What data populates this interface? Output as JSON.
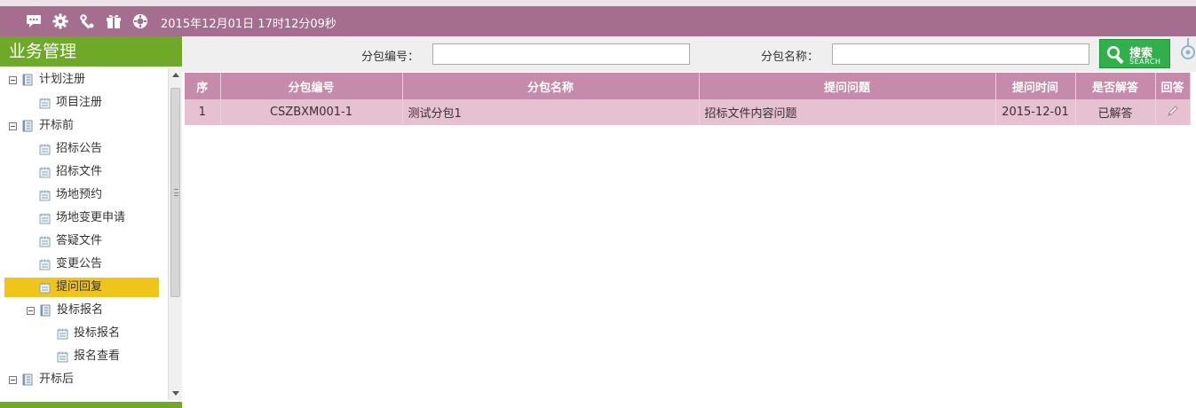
{
  "header": {
    "datetime": "2015年12月01日 17时12分09秒",
    "icons": [
      "chat-bubble-icon",
      "gear-icon",
      "tools-icon",
      "gift-icon",
      "help-lifebuoy-icon"
    ]
  },
  "sidebar": {
    "title": "业务管理",
    "tree": [
      {
        "label": "计划注册",
        "level": 0,
        "kind": "group"
      },
      {
        "label": "项目注册",
        "level": 1,
        "kind": "leaf"
      },
      {
        "label": "开标前",
        "level": 0,
        "kind": "group"
      },
      {
        "label": "招标公告",
        "level": 1,
        "kind": "leaf"
      },
      {
        "label": "招标文件",
        "level": 1,
        "kind": "leaf"
      },
      {
        "label": "场地预约",
        "level": 1,
        "kind": "leaf"
      },
      {
        "label": "场地变更申请",
        "level": 1,
        "kind": "leaf"
      },
      {
        "label": "答疑文件",
        "level": 1,
        "kind": "leaf"
      },
      {
        "label": "变更公告",
        "level": 1,
        "kind": "leaf"
      },
      {
        "label": "提问回复",
        "level": 1,
        "kind": "leaf",
        "active": true
      },
      {
        "label": "投标报名",
        "level": 1,
        "kind": "group"
      },
      {
        "label": "投标报名",
        "level": 2,
        "kind": "leaf"
      },
      {
        "label": "报名查看",
        "level": 2,
        "kind": "leaf"
      },
      {
        "label": "开标后",
        "level": 0,
        "kind": "group"
      }
    ]
  },
  "search": {
    "code_label": "分包编号：",
    "code_value": "",
    "name_label": "分包名称：",
    "name_value": "",
    "button_label": "搜索",
    "button_sub": "SEARCH"
  },
  "table": {
    "headers": [
      "序",
      "分包编号",
      "分包名称",
      "提问问题",
      "提问时间",
      "是否解答",
      "回答"
    ],
    "rows": [
      {
        "no": "1",
        "code": "CSZBXM001-1",
        "name": "测试分包1",
        "question": "招标文件内容问题",
        "time": "2015-12-01",
        "answered": "已解答"
      }
    ]
  },
  "colors": {
    "header_bar": "#a56d8e",
    "sidebar_title": "#6eaa28",
    "active_item": "#f0c419",
    "table_header": "#c68aab",
    "table_row": "#e5c1d1",
    "search_button": "#2fb04a"
  }
}
